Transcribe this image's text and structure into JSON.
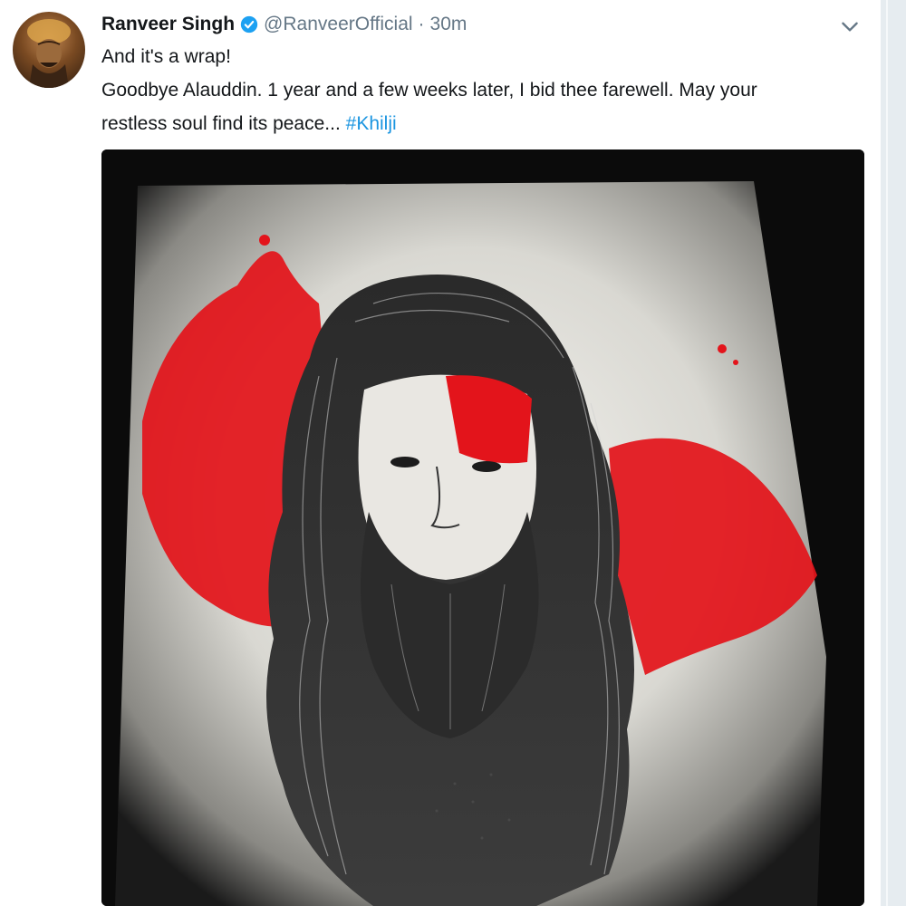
{
  "tweet": {
    "author_name": "Ranveer Singh",
    "handle": "@RanveerOfficial",
    "separator": "·",
    "time": "30m",
    "line1": "And it's a wrap!",
    "line2": "Goodbye Alauddin. 1 year and a few weeks later, I bid thee farewell. May your",
    "line3_text": "restless soul find its peace...",
    "hashtag": "#Khilji"
  },
  "icons": {
    "verified": "verified-badge-icon",
    "menu": "chevron-down-icon"
  },
  "colors": {
    "verified_blue": "#1da1f2",
    "hashtag_blue": "#1b95e0",
    "handle_gray": "#657786",
    "paint_red": "#e3141b"
  }
}
